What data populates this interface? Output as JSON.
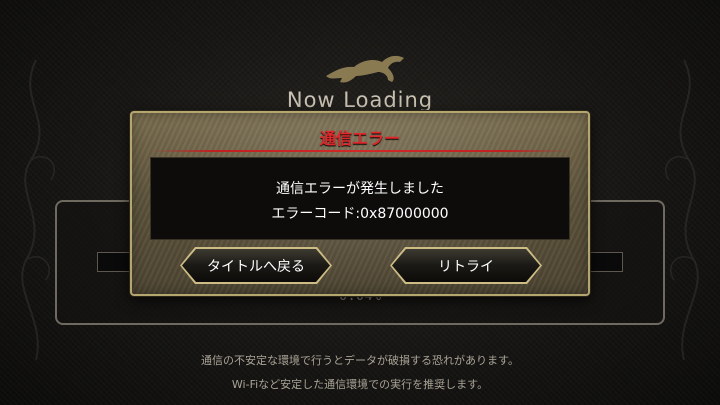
{
  "background": {
    "logo_icon": "running-horse-icon",
    "loading_text": "Now Loading",
    "progress_text": "0.04%",
    "progress_fraction": 0.0004,
    "notice_line1": "通信の不安定な環境で行うとデータが破損する恐れがあります。",
    "notice_line2": "Wi-Fiなど安定した通信環境での実行を推奨します。"
  },
  "dialog": {
    "title": "通信エラー",
    "message_line1": "通信エラーが発生しました",
    "message_line2": "エラーコード:0x87000000",
    "back_button_label": "タイトルへ戻る",
    "retry_button_label": "リトライ"
  },
  "colors": {
    "dialog_border": "#b5a56e",
    "title_red": "#e0282b",
    "button_border": "#cdbd85"
  }
}
